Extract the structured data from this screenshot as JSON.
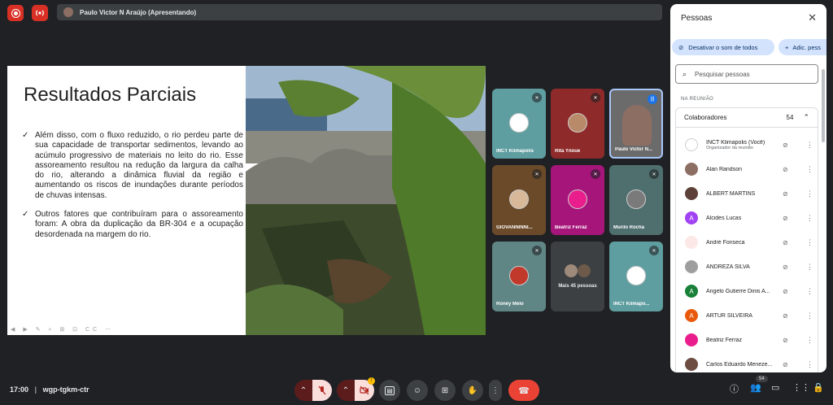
{
  "top": {
    "presenter_label": "Paulo Victor N Araújo (Apresentando)"
  },
  "slide": {
    "title": "Resultados Parciais",
    "bullets": [
      "Além disso, com o fluxo reduzido, o rio perdeu parte de sua capacidade de transportar sedimentos, levando ao acúmulo progressivo de materiais no leito do rio. Esse assoreamento resultou na redução da largura da calha do rio, alterando a dinâmica fluvial da região e aumentando os riscos de inundações durante períodos de chuvas intensas.",
      "Outros fatores que contribuíram para o assoreamento foram: A obra da duplicação da BR-304 e a ocupação desordenada na margem do rio."
    ],
    "caption_button": "CC"
  },
  "tiles": [
    {
      "name": "INCT Klimapolis"
    },
    {
      "name": "Rita Ynoue"
    },
    {
      "name": "Paulo Victor N..."
    },
    {
      "name": "GIOVANNINNI..."
    },
    {
      "name": "Beatriz Ferraz"
    },
    {
      "name": "Murilo Rocha"
    },
    {
      "name": "Roney Melo"
    },
    {
      "name": "Mais 45 pessoas"
    },
    {
      "name": "INCT Klimapo..."
    }
  ],
  "panel": {
    "title": "Pessoas",
    "mute_all": "Desativar o som de todos",
    "add_people": "Adic. pess",
    "search_placeholder": "Pesquisar pessoas",
    "section": "NA REUNIÃO",
    "group_name": "Colaboradores",
    "group_count": "54",
    "people": [
      {
        "name": "INCT Klimapolis (Você)",
        "sub": "Organizador da reunião",
        "initial": "",
        "color": "#ffffff"
      },
      {
        "name": "Alan Randson",
        "sub": "",
        "initial": "",
        "color": "#8d6e63"
      },
      {
        "name": "ALBERT MARTINS",
        "sub": "",
        "initial": "",
        "color": "#5d4037"
      },
      {
        "name": "Alcides Lucas",
        "sub": "",
        "initial": "A",
        "color": "#a142f4"
      },
      {
        "name": "André Fonseca",
        "sub": "",
        "initial": "",
        "color": "#fce8e6"
      },
      {
        "name": "ANDREZA SILVA",
        "sub": "",
        "initial": "",
        "color": "#9e9e9e"
      },
      {
        "name": "Angelo Gutierre Dinis A...",
        "sub": "",
        "initial": "A",
        "color": "#188038"
      },
      {
        "name": "ARTUR SILVEIRA",
        "sub": "",
        "initial": "A",
        "color": "#e8590c"
      },
      {
        "name": "Beatriz Ferraz",
        "sub": "",
        "initial": "",
        "color": "#e91e8c"
      },
      {
        "name": "Carlos Eduardo Meneze...",
        "sub": "",
        "initial": "",
        "color": "#6d4c41"
      }
    ]
  },
  "bottom": {
    "time": "17:00",
    "separator": "|",
    "meeting_code": "wgp-tgkm-ctr",
    "people_badge": "54"
  }
}
